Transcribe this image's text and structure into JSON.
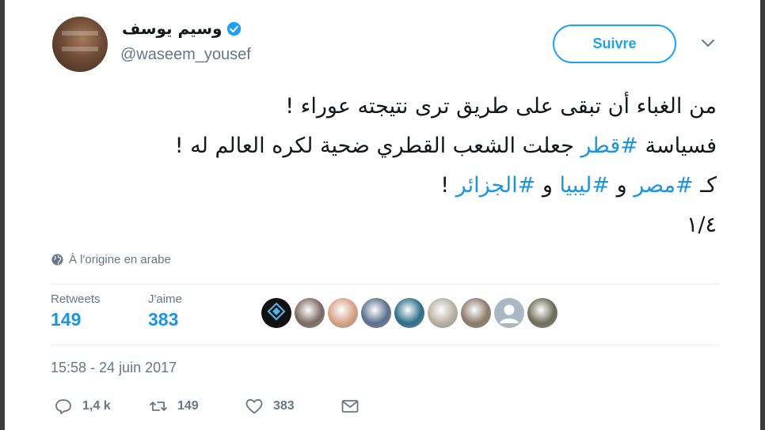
{
  "author": {
    "display_name": "وسيم يوسف",
    "handle": "@waseem_yousef",
    "verified": true
  },
  "follow_button": {
    "label": "Suivre"
  },
  "tweet": {
    "line1": "من الغباء أن تبقى على طريق ترى نتيجته عوراء !",
    "line2_prefix": "فسياسة ",
    "line2_hashtag": "#قطر",
    "line2_suffix": " جعلت الشعب القطري ضحية لكره العالم له !",
    "line3_prefix": "كـ ",
    "line3_hashtag1": "#مصر",
    "line3_sep1": " و ",
    "line3_hashtag2": "#ليبيا",
    "line3_sep2": " و ",
    "line3_hashtag3": "#الجزائر",
    "line3_suffix": " !",
    "line4": "١/٤"
  },
  "translation": {
    "label": "À l'origine en arabe"
  },
  "stats": {
    "retweets_label": "Retweets",
    "retweets_value": "149",
    "likes_label": "J'aime",
    "likes_value": "383"
  },
  "likers": [
    {
      "icon": "avatar-diamond-logo",
      "color": "#111111"
    },
    {
      "icon": "avatar-photo",
      "color": "#7d6a62"
    },
    {
      "icon": "avatar-photo",
      "color": "#d7a184"
    },
    {
      "icon": "avatar-photo",
      "color": "#5a6f8e"
    },
    {
      "icon": "avatar-butterfly",
      "color": "#2c6d8a"
    },
    {
      "icon": "avatar-photo",
      "color": "#b8b0a4"
    },
    {
      "icon": "avatar-photo",
      "color": "#8c7a6b"
    },
    {
      "icon": "avatar-default-silhouette",
      "color": "#aab8c2"
    },
    {
      "icon": "avatar-photo",
      "color": "#6d6d5a"
    }
  ],
  "timestamp": "15:58 - 24 juin 2017",
  "actions": {
    "reply_count": "1,4 k",
    "retweet_count": "149",
    "like_count": "383"
  },
  "colors": {
    "accent": "#1da1f2",
    "link": "#1b95e0",
    "muted": "#657786",
    "divider": "#e6ecf0"
  }
}
